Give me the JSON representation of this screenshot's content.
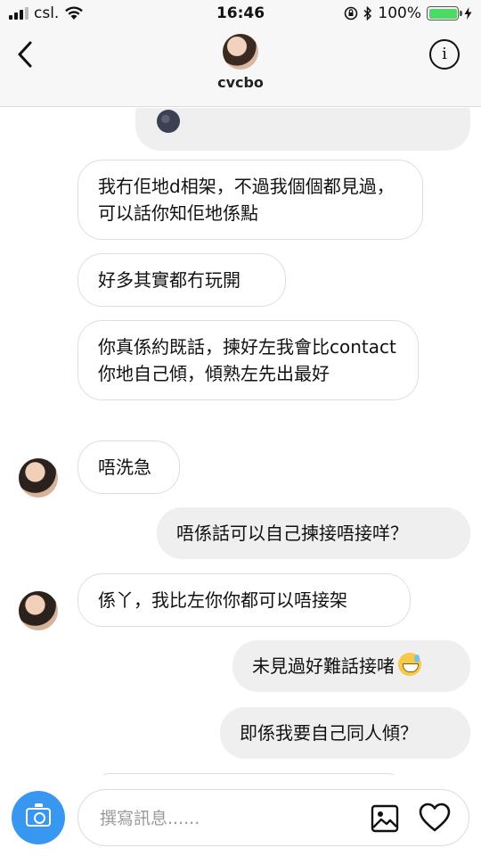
{
  "status_bar": {
    "carrier": "csl.",
    "time": "16:46",
    "battery_percent": "100%",
    "battery_level": 1.0,
    "icons": [
      "signal-icon",
      "wifi-icon",
      "lock-rotation-icon",
      "bluetooth-icon",
      "battery-icon",
      "charging-icon"
    ]
  },
  "header": {
    "username": "cvcbo",
    "back_icon": "chevron-left-icon",
    "info_icon": "info-icon"
  },
  "messages": [
    {
      "side": "sent",
      "text": "",
      "emoji": "new-moon-face"
    },
    {
      "side": "received",
      "text": "我冇佢地d相架，不過我個個都見過，可以話你知佢地係點"
    },
    {
      "side": "received",
      "text": "好多其實都冇玩開"
    },
    {
      "side": "received",
      "text": "你真係約既話，揀好左我會比contact你地自己傾，傾熟左先出最好"
    },
    {
      "side": "received",
      "text": "唔洗急"
    },
    {
      "side": "sent",
      "text": "唔係話可以自己揀接唔接咩？"
    },
    {
      "side": "received",
      "text": "係丫，我比左你你都可以唔接架"
    },
    {
      "side": "sent",
      "text": "未見過好難話接啫",
      "emoji": "grinning-sweat"
    },
    {
      "side": "sent",
      "text": "即係我要自己同人傾？"
    }
  ],
  "composer": {
    "placeholder": "撰寫訊息......",
    "camera_icon": "camera-icon",
    "gallery_icon": "gallery-icon",
    "heart_icon": "heart-icon"
  },
  "colors": {
    "accent": "#3897f0",
    "sent_bubble": "#efefef",
    "received_bubble": "#ffffff",
    "battery": "#4cd964"
  }
}
